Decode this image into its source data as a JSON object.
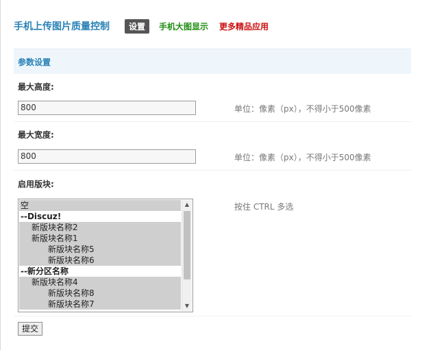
{
  "header": {
    "app_title": "手机上传图片质量控制",
    "tabs": [
      {
        "label": "设置"
      },
      {
        "label": "手机大图显示"
      },
      {
        "label": "更多精品应用"
      }
    ]
  },
  "section": {
    "title": "参数设置"
  },
  "fields": {
    "max_height": {
      "label": "最大高度:",
      "value": "800",
      "hint": "单位：像素（px），不得小于500像素"
    },
    "max_width": {
      "label": "最大宽度:",
      "value": "800",
      "hint": "单位：像素（px），不得小于500像素"
    },
    "forums": {
      "label": "启用版块:",
      "hint": "按住 CTRL 多选",
      "options": [
        {
          "label": "空",
          "level": "l0",
          "group": false
        },
        {
          "label": "--Discuz!",
          "level": "lg",
          "group": true
        },
        {
          "label": "新版块名称2",
          "level": "l1",
          "group": false
        },
        {
          "label": "新版块名称1",
          "level": "l1",
          "group": false
        },
        {
          "label": "新版块名称5",
          "level": "l2",
          "group": false
        },
        {
          "label": "新版块名称6",
          "level": "l2",
          "group": false
        },
        {
          "label": "--新分区名称",
          "level": "lg",
          "group": true
        },
        {
          "label": "新版块名称4",
          "level": "l1",
          "group": false
        },
        {
          "label": "新版块名称8",
          "level": "l2",
          "group": false
        },
        {
          "label": "新版块名称7",
          "level": "l2",
          "group": false
        }
      ]
    }
  },
  "submit_label": "提交",
  "colors": {
    "accent": "#2a82b5",
    "green_tab": "#1f8e12",
    "red_tab": "#cc1111",
    "selected_bg": "#cfcfcf"
  }
}
